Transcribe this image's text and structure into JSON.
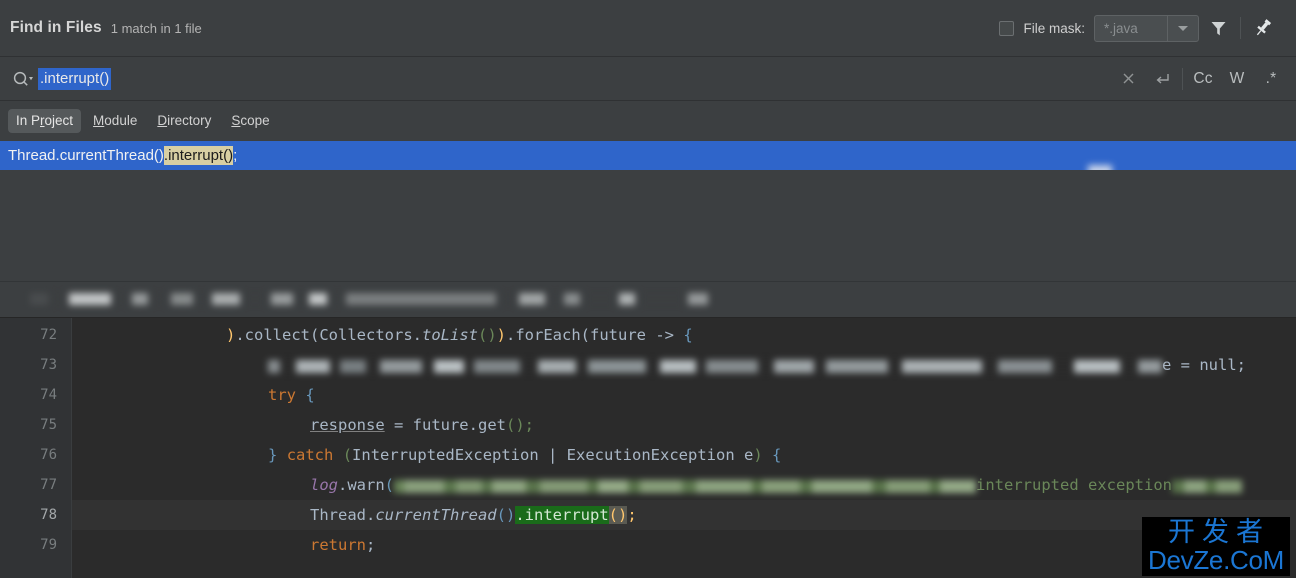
{
  "dialog": {
    "title": "Find in Files",
    "subtitle": "1 match in 1 file"
  },
  "filemask": {
    "label": "File mask:",
    "checked": false,
    "value": "*.java",
    "dropdown_icon": "chevron-down-icon",
    "filter_icon": "filter-icon",
    "pin_icon": "pin-icon"
  },
  "search": {
    "value": ".interrupt()",
    "magnifier_icon": "search-icon",
    "buttons": {
      "clear": "×",
      "newline": "↵",
      "match_case": "Cc",
      "words": "W",
      "regex": ".*"
    }
  },
  "scope_tabs": [
    {
      "label": "In Project",
      "accel_before": "In P",
      "accel": "r",
      "accel_after": "oject",
      "active": true
    },
    {
      "label": "Module",
      "accel_before": "",
      "accel": "M",
      "accel_after": "odule",
      "active": false
    },
    {
      "label": "Directory",
      "accel_before": "",
      "accel": "D",
      "accel_after": "irectory",
      "active": false
    },
    {
      "label": "Scope",
      "accel_before": "",
      "accel": "S",
      "accel_after": "cope",
      "active": false
    }
  ],
  "results": [
    {
      "prefix": "Thread.currentThread()",
      "match": ".interrupt()",
      "suffix": ";",
      "selected": true
    }
  ],
  "preview": {
    "path_blurred": true,
    "lines": [
      {
        "number": "72",
        "blurred": false,
        "tokens": [
          {
            "t": ").collect(",
            "c": "br-y-open"
          },
          {
            "t": "Collectors.",
            "c": "plain"
          },
          {
            "t": "toList",
            "c": "italic"
          },
          {
            "t": "()",
            "c": "br-green"
          },
          {
            "t": ").forEach(",
            "c": "plain"
          },
          {
            "t": "future -> {",
            "c": "plain"
          }
        ],
        "text": ").collect(Collectors.toList()).forEach(future -> {"
      },
      {
        "number": "73",
        "blurred": true,
        "tail": "e = null;",
        "text": ""
      },
      {
        "number": "74",
        "blurred": false,
        "text": "try {"
      },
      {
        "number": "75",
        "blurred": false,
        "text": "response = future.get();"
      },
      {
        "number": "76",
        "blurred": false,
        "text": "} catch (InterruptedException | ExecutionException e) {"
      },
      {
        "number": "77",
        "blurred": true,
        "prefix": "log.warn(",
        "tail": "interrupted exception",
        "text": "log.warn("
      },
      {
        "number": "78",
        "blurred": false,
        "highlighted": true,
        "text": "Thread.currentThread().interrupt();",
        "match": ".interrupt"
      },
      {
        "number": "79",
        "blurred": false,
        "text": "return;"
      }
    ]
  },
  "watermark": {
    "line1": "开发者",
    "line2": "DevZe.CoM"
  },
  "colors": {
    "panel": "#3c3f41",
    "editor": "#2b2b2b",
    "gutter": "#313335",
    "selection": "#2f65ca",
    "result_match": "#d8cfa3",
    "code_match": "#1a6b1a",
    "keyword": "#cc7832",
    "string": "#6a8759",
    "method": "#ffc66d",
    "field": "#9876aa",
    "text": "#a9b7c6"
  }
}
